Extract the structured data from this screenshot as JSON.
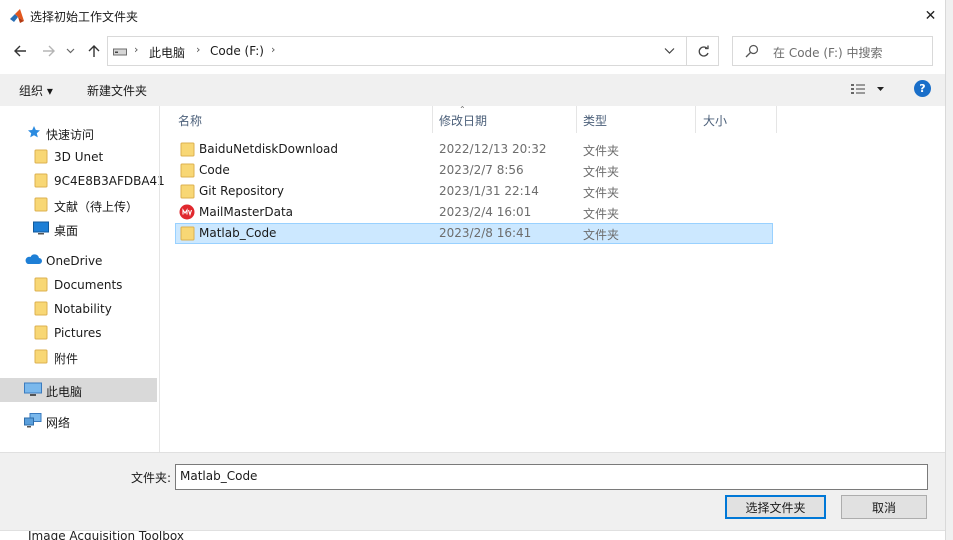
{
  "window": {
    "title": "选择初始工作文件夹",
    "close_glyph": "✕"
  },
  "address_bar": {
    "crumbs": [
      "此电脑",
      "Code (F:)"
    ],
    "separator": "›"
  },
  "search": {
    "placeholder": "在 Code (F:) 中搜索"
  },
  "toolbar": {
    "organize_label": "组织 ▾",
    "new_folder_label": "新建文件夹",
    "help_label": "?"
  },
  "nav_pane": {
    "quick_access": "快速访问",
    "quick_items": [
      "3D Unet",
      "9C4E8B3AFDBA41",
      "文献（待上传）",
      "桌面"
    ],
    "onedrive": "OneDrive",
    "onedrive_items": [
      "Documents",
      "Notability",
      "Pictures",
      "附件"
    ],
    "this_pc": "此电脑",
    "network": "网络"
  },
  "file_list": {
    "columns": [
      "名称",
      "修改日期",
      "类型",
      "大小"
    ],
    "rows": [
      {
        "name": "BaiduNetdiskDownload",
        "date": "2022/12/13 20:32",
        "type": "文件夹",
        "icon": "folder-icon"
      },
      {
        "name": "Code",
        "date": "2023/2/7 8:56",
        "type": "文件夹",
        "icon": "folder-icon"
      },
      {
        "name": "Git Repository",
        "date": "2023/1/31 22:14",
        "type": "文件夹",
        "icon": "folder-icon"
      },
      {
        "name": "MailMasterData",
        "date": "2023/2/4 16:01",
        "type": "文件夹",
        "icon": "mailmaster-icon"
      },
      {
        "name": "Matlab_Code",
        "date": "2023/2/8 16:41",
        "type": "文件夹",
        "icon": "folder-icon",
        "selected": true
      }
    ]
  },
  "bottom": {
    "folder_label": "文件夹:",
    "folder_value": "Matlab_Code",
    "select_button": "选择文件夹",
    "cancel_button": "取消"
  },
  "behind_window": {
    "text": "Image Acquisition Toolbox"
  },
  "colors": {
    "accent": "#0078d7",
    "selection": "#cce8ff",
    "folder": "#f8d775"
  }
}
